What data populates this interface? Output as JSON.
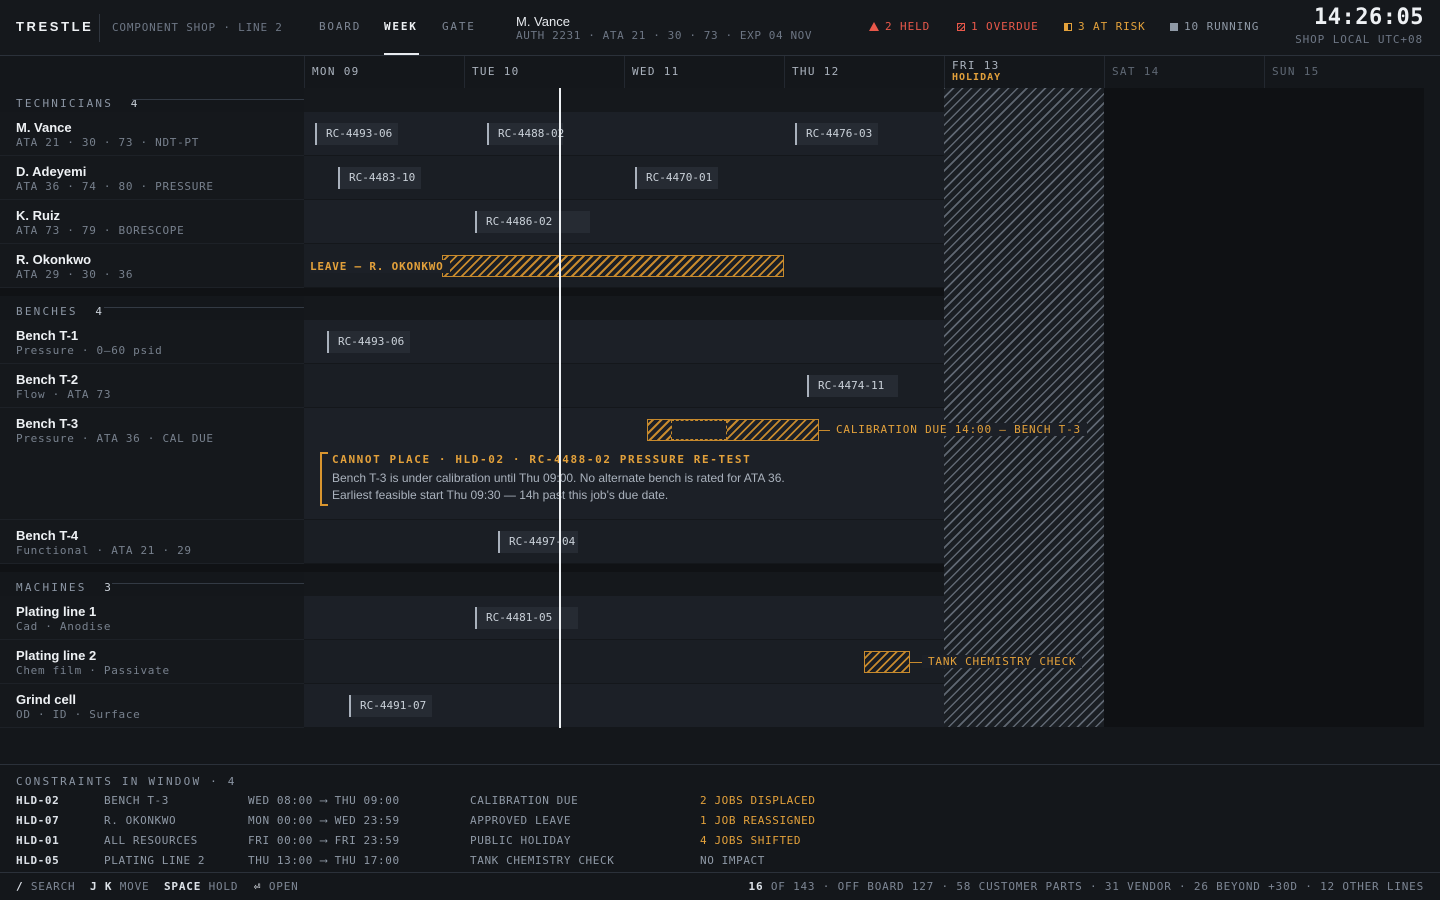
{
  "header": {
    "brand": "TRESTLE",
    "subtitle": "COMPONENT SHOP · LINE 2",
    "tabs": [
      "BOARD",
      "WEEK",
      "GATE"
    ],
    "active_tab": "WEEK",
    "user_name": "M. Vance",
    "user_detail": "AUTH 2231 · ATA 21 · 30 · 73 · EXP 04 NOV",
    "stats": {
      "held": "2 HELD",
      "overdue": "1 OVERDUE",
      "at_risk": "3 AT RISK",
      "running": "10 RUNNING"
    },
    "clock": "14:26:05",
    "timezone": "SHOP LOCAL UTC+08"
  },
  "days": [
    {
      "label": "MON 09"
    },
    {
      "label": "TUE 10"
    },
    {
      "label": "WED 11"
    },
    {
      "label": "THU 12"
    },
    {
      "label": "FRI 13",
      "sub": "HOLIDAY"
    },
    {
      "label": "SAT 14"
    },
    {
      "label": "SUN 15"
    }
  ],
  "sections": {
    "technicians": {
      "label": "TECHNICIANS",
      "count": "4"
    },
    "benches": {
      "label": "BENCHES",
      "count": "4"
    },
    "machines": {
      "label": "MACHINES",
      "count": "3"
    }
  },
  "rows": {
    "vance": {
      "name": "M. Vance",
      "sub": "ATA 21 · 30 · 73 · NDT-PT"
    },
    "adeyemi": {
      "name": "D. Adeyemi",
      "sub": "ATA 36 · 74 · 80 · PRESSURE"
    },
    "ruiz": {
      "name": "K. Ruiz",
      "sub": "ATA 73 · 79 · BORESCOPE"
    },
    "okonkwo": {
      "name": "R. Okonkwo",
      "sub": "ATA 29 · 30 · 36"
    },
    "t1": {
      "name": "Bench T-1",
      "sub": "Pressure · 0–60 psid"
    },
    "t2": {
      "name": "Bench T-2",
      "sub": "Flow · ATA 73"
    },
    "t3": {
      "name": "Bench T-3",
      "sub": "Pressure · ATA 36 · CAL DUE"
    },
    "t4": {
      "name": "Bench T-4",
      "sub": "Functional · ATA 21 · 29"
    },
    "plating1": {
      "name": "Plating line 1",
      "sub": "Cad · Anodise"
    },
    "plating2": {
      "name": "Plating line 2",
      "sub": "Chem film · Passivate"
    },
    "grind": {
      "name": "Grind cell",
      "sub": "OD · ID · Surface"
    }
  },
  "jobs": {
    "j1": "RC-4493-06",
    "j2": "RC-4488-02",
    "j3": "RC-4476-03",
    "j4": "RC-4483-10",
    "j5": "RC-4470-01",
    "j6": "RC-4486-02",
    "j7": "RC-4493-06",
    "j8": "RC-4474-11",
    "j9": "RC-4497-04",
    "j10": "RC-4481-05",
    "j11": "RC-4491-07"
  },
  "leave_label": "LEAVE — R. OKONKWO",
  "calibration_label": "CALIBRATION DUE 14:00 — BENCH T-3",
  "tank_label": "TANK CHEMISTRY CHECK",
  "cannot_place": {
    "title": "CANNOT PLACE · HLD-02 · RC-4488-02 PRESSURE RE-TEST",
    "body": "Bench T-3 is under calibration until Thu 09:00. No alternate bench is rated for ATA 36. Earliest feasible start Thu 09:30 — 14h past this job's due date."
  },
  "constraints": {
    "title": "CONSTRAINTS IN WINDOW · 4",
    "items": [
      {
        "id": "HLD-02",
        "resource": "BENCH T-3",
        "window": "WED 08:00 ⟶ THU 09:00",
        "reason": "CALIBRATION DUE",
        "impact": "2 JOBS DISPLACED"
      },
      {
        "id": "HLD-07",
        "resource": "R. OKONKWO",
        "window": "MON 00:00 ⟶ WED 23:59",
        "reason": "APPROVED LEAVE",
        "impact": "1 JOB REASSIGNED"
      },
      {
        "id": "HLD-01",
        "resource": "ALL RESOURCES",
        "window": "FRI 00:00 ⟶ FRI 23:59",
        "reason": "PUBLIC HOLIDAY",
        "impact": "4 JOBS SHIFTED"
      },
      {
        "id": "HLD-05",
        "resource": "PLATING LINE 2",
        "window": "THU 13:00 ⟶ THU 17:00",
        "reason": "TANK CHEMISTRY CHECK",
        "impact": "NO IMPACT"
      }
    ]
  },
  "footer": {
    "k1": "/",
    "k1_label": "SEARCH",
    "k2": "J K",
    "k2_label": "MOVE",
    "k3": "SPACE",
    "k3_label": "HOLD",
    "k4": "⏎",
    "k4_label": "OPEN",
    "count": "16",
    "count_rest": "OF 143 · OFF BOARD 127 · 58 CUSTOMER PARTS · 31 VENDOR · 26 BEYOND +30D · 12 OTHER LINES"
  },
  "colors": {
    "accent_amber": "#e3a13b",
    "alert_red": "#e8584a",
    "background": "#14171b"
  }
}
